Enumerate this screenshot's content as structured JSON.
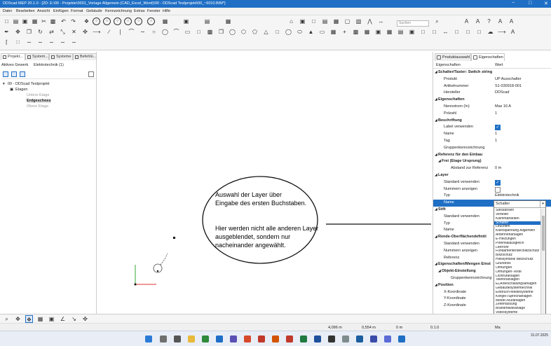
{
  "window": {
    "title": "DDScad MEP 20.1.0 - [2D: E:\\00 - Projekte\\0001_Vorlage Allgemein (CAD_Excel_Word)\\00 - DDScad Testprojekt\\00_~6010.BIM*]",
    "minimize": "−",
    "maximize": "□",
    "close": "✕"
  },
  "menu": [
    "Datei",
    "Bearbeiten",
    "Ansicht",
    "Einfügen",
    "Format",
    "Gebäude",
    "Kennzeichnung",
    "Extras",
    "Fenster",
    "Hilfe"
  ],
  "search_placeholder": "Suchen",
  "left_panel": {
    "tabs": [
      "Projekt...",
      "System...",
      "Systeme",
      "Befehlü..."
    ],
    "active_gewerk_label": "Aktives Gewerk",
    "active_gewerk_value": "Elektrotechnik (1)",
    "tree": {
      "root": "00 - DDScad Testprojekt",
      "etagen": "Etagen",
      "levels": [
        "Untere Etage",
        "Erdgeschoss",
        "Obere Etage"
      ]
    }
  },
  "annotation": {
    "line1": "Auswahl der Layer über",
    "line2": "Eingabe des ersten Buchstaben.",
    "line3": "Hier werden nicht alle anderen Layer",
    "line4": "ausgeblendet, sondern nur",
    "line5": "nacheinander angewählt."
  },
  "right_panel": {
    "tabs": [
      "Produktauswahl",
      "Eigenschaften"
    ],
    "col_property": "Eigenschaften",
    "col_value": "Wert",
    "rows": [
      {
        "k": "Schalter/Taster: Switch string",
        "t": "sec"
      },
      {
        "k": "Produkt",
        "v": "UP Ausschalter"
      },
      {
        "k": "Artikelnummer",
        "v": "S1-030918-001"
      },
      {
        "k": "Hersteller",
        "v": "DDScad"
      },
      {
        "k": "Eigenschaften",
        "t": "sec"
      },
      {
        "k": "Nennstrom (In)",
        "v": "Max 16 A"
      },
      {
        "k": "Polzahl",
        "v": "1"
      },
      {
        "k": "Beschriftung",
        "t": "sec"
      },
      {
        "k": "Label verwenden",
        "b": "on"
      },
      {
        "k": "Name",
        "v": "1"
      },
      {
        "k": "Tag",
        "v": "1"
      },
      {
        "k": "Gruppenkennzeichnung"
      },
      {
        "k": "Referenz für den Einbau",
        "t": "sec"
      },
      {
        "k": "Frei (Etage Ursprung)",
        "t": "sub"
      },
      {
        "k": "Abstand zur Referenz",
        "v": "0 m",
        "t": "deep"
      },
      {
        "k": "Layer",
        "t": "sec"
      },
      {
        "k": "Standard verwenden",
        "b": "on"
      },
      {
        "k": "Nummern anzeigen",
        "b": "off"
      },
      {
        "k": "Typ",
        "v": "Elektrotechnik"
      },
      {
        "k": "Name",
        "t": "sel"
      },
      {
        "k": "Stift",
        "t": "sec"
      },
      {
        "k": "Standard verwenden"
      },
      {
        "k": "Typ"
      },
      {
        "k": "Name"
      },
      {
        "k": "Rende-Oberflächendefiniti",
        "t": "sec"
      },
      {
        "k": "Standard verwenden"
      },
      {
        "k": "Nummern anzeigen"
      },
      {
        "k": "Referenz"
      },
      {
        "k": "Eigenschaften/Mengen Einst",
        "t": "sec"
      },
      {
        "k": "Objekt-Einstellung",
        "t": "sub"
      },
      {
        "k": "Gruppenkennzeichnung",
        "t": "deep"
      },
      {
        "k": "Position",
        "t": "sec"
      },
      {
        "k": "X-Koordinate"
      },
      {
        "k": "Y-Koordinate"
      },
      {
        "k": "Z-Koordinate"
      }
    ]
  },
  "dropdown": {
    "current": "Schalter",
    "selected_index": 3,
    "items": [
      "Steckdosen",
      "Verteiler",
      "Klemmarbeiten",
      "Schalter",
      "Leuchten",
      "Kleinspannung Allgemein",
      "Antennenanlagen",
      "E-Heizungen",
      "Potentialausgleich",
      "Leerrohr",
      "Fundamenterder/Blitzschutz",
      "Blitzschutz",
      "Hilfssymbole Blitzschutz",
      "Grundriss",
      "Öffnungen",
      "Öffnungen-Texte",
      "Lichtrufanlagen",
      "Telefonanlagen",
      "ELA/Beschallungsanlagen",
      "Gebäudesystemtechnik",
      "Einbruch-Meldesysteme",
      "Klingel-/Sprechanlagen",
      "Melde-/Rufanlagen",
      "Zeiterfassung",
      "Brandmeldeanlage",
      "Videosysteme",
      "Datennetz",
      "Datennetz-Einrichtungen",
      "RWA-Anlage",
      "Gefahrenwarn-Anlage"
    ]
  },
  "status": {
    "x": "4,096 m",
    "y": "0,554 m",
    "z": "0 m",
    "zoom": "0.1.0",
    "extra": "Ma"
  },
  "clock": {
    "time": "",
    "date": "31.07.2025"
  },
  "colors": {
    "accent": "#1f6fc5",
    "titlebar": "#1f6fc5"
  }
}
